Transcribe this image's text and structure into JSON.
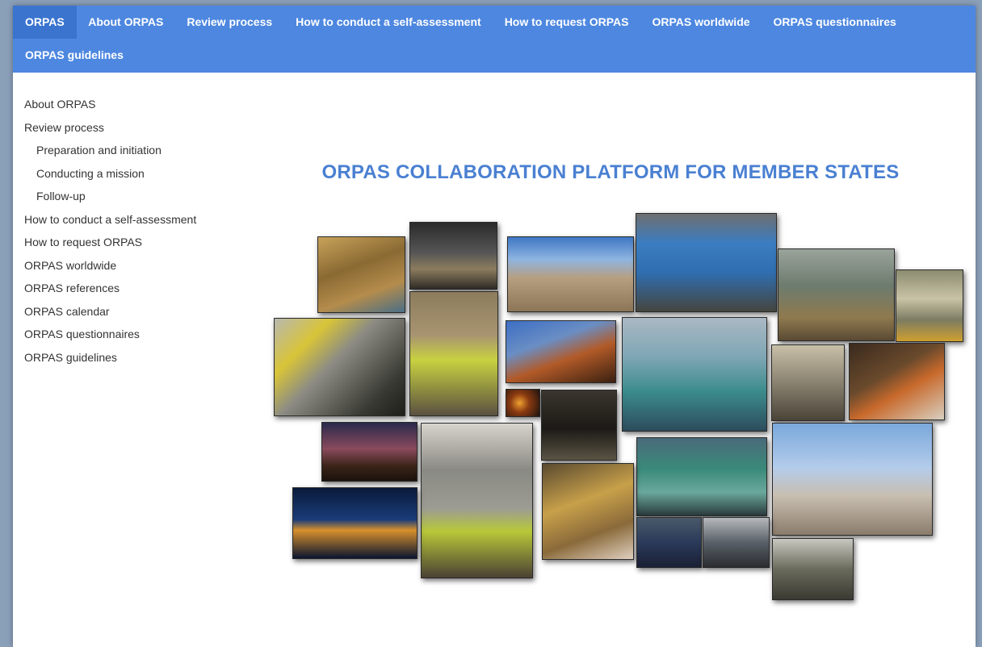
{
  "topnav": {
    "items": [
      {
        "label": "ORPAS",
        "active": true
      },
      {
        "label": "About ORPAS"
      },
      {
        "label": "Review process"
      },
      {
        "label": "How to conduct a self-assessment"
      },
      {
        "label": "How to request ORPAS"
      },
      {
        "label": "ORPAS worldwide"
      },
      {
        "label": "ORPAS questionnaires"
      },
      {
        "label": "ORPAS guidelines"
      }
    ]
  },
  "sidebar": {
    "items": [
      {
        "label": "About ORPAS"
      },
      {
        "label": "Review process"
      },
      {
        "label": "Preparation and initiation",
        "sub": true
      },
      {
        "label": "Conducting a mission",
        "sub": true
      },
      {
        "label": "Follow-up",
        "sub": true
      },
      {
        "label": "How to conduct a self-assessment"
      },
      {
        "label": "How to request ORPAS"
      },
      {
        "label": "ORPAS worldwide"
      },
      {
        "label": "ORPAS references"
      },
      {
        "label": "ORPAS calendar"
      },
      {
        "label": "ORPAS questionnaires"
      },
      {
        "label": "ORPAS guidelines"
      }
    ]
  },
  "main": {
    "title": "ORPAS COLLABORATION PLATFORM FOR MEMBER STATES"
  },
  "colors": {
    "nav_bg": "#4d87e0",
    "nav_active": "#3a74cf",
    "title": "#4a80d2"
  }
}
